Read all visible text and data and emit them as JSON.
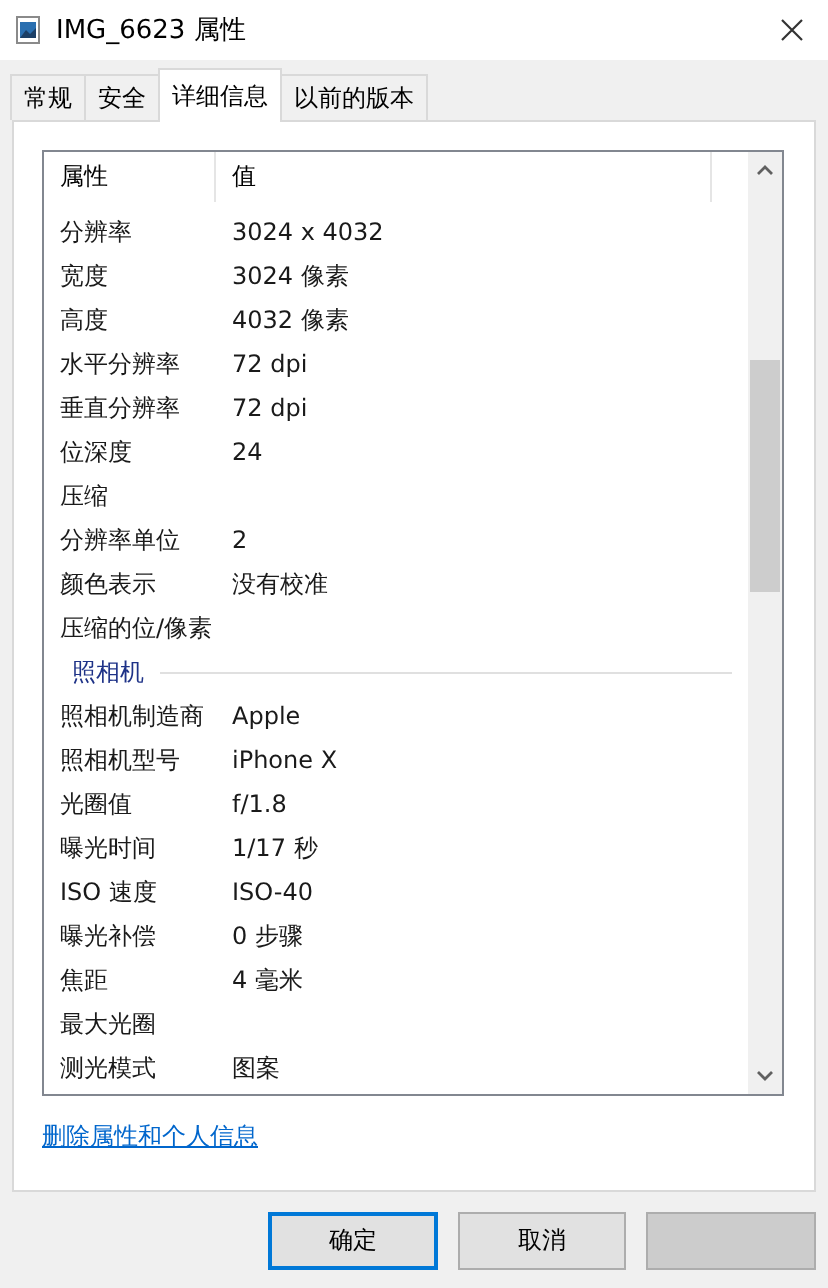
{
  "window": {
    "title": "IMG_6623 属性"
  },
  "tabs": [
    {
      "label": "常规",
      "selected": false
    },
    {
      "label": "安全",
      "selected": false
    },
    {
      "label": "详细信息",
      "selected": true
    },
    {
      "label": "以前的版本",
      "selected": false
    }
  ],
  "table": {
    "columns": [
      "属性",
      "值"
    ],
    "rows": [
      {
        "kind": "property",
        "name": "分辨率",
        "value": "3024 x 4032"
      },
      {
        "kind": "property",
        "name": "宽度",
        "value": "3024 像素"
      },
      {
        "kind": "property",
        "name": "高度",
        "value": "4032 像素"
      },
      {
        "kind": "property",
        "name": "水平分辨率",
        "value": "72 dpi"
      },
      {
        "kind": "property",
        "name": "垂直分辨率",
        "value": "72 dpi"
      },
      {
        "kind": "property",
        "name": "位深度",
        "value": "24"
      },
      {
        "kind": "property",
        "name": "压缩"
      },
      {
        "kind": "property",
        "name": "分辨率单位",
        "value": "2"
      },
      {
        "kind": "property",
        "name": "颜色表示",
        "value": "没有校准"
      },
      {
        "kind": "property",
        "name": "压缩的位/像素"
      },
      {
        "kind": "section",
        "name": "照相机"
      },
      {
        "kind": "property",
        "name": "照相机制造商",
        "value": "Apple"
      },
      {
        "kind": "property",
        "name": "照相机型号",
        "value": "iPhone X"
      },
      {
        "kind": "property",
        "name": "光圈值",
        "value": "f/1.8"
      },
      {
        "kind": "property",
        "name": "曝光时间",
        "value": "1/17 秒"
      },
      {
        "kind": "property",
        "name": "ISO 速度",
        "value": "ISO-40"
      },
      {
        "kind": "property",
        "name": "曝光补偿",
        "value": "0 步骤"
      },
      {
        "kind": "property",
        "name": "焦距",
        "value": "4 毫米"
      },
      {
        "kind": "property",
        "name": "最大光圈"
      },
      {
        "kind": "property",
        "name": "测光模式",
        "value": "图案"
      }
    ]
  },
  "link": "删除属性和个人信息",
  "buttons": [
    {
      "label": "确定",
      "default": true,
      "disabled": false
    },
    {
      "label": "取消",
      "default": false,
      "disabled": false
    },
    {
      "default": false,
      "disabled": true
    }
  ]
}
